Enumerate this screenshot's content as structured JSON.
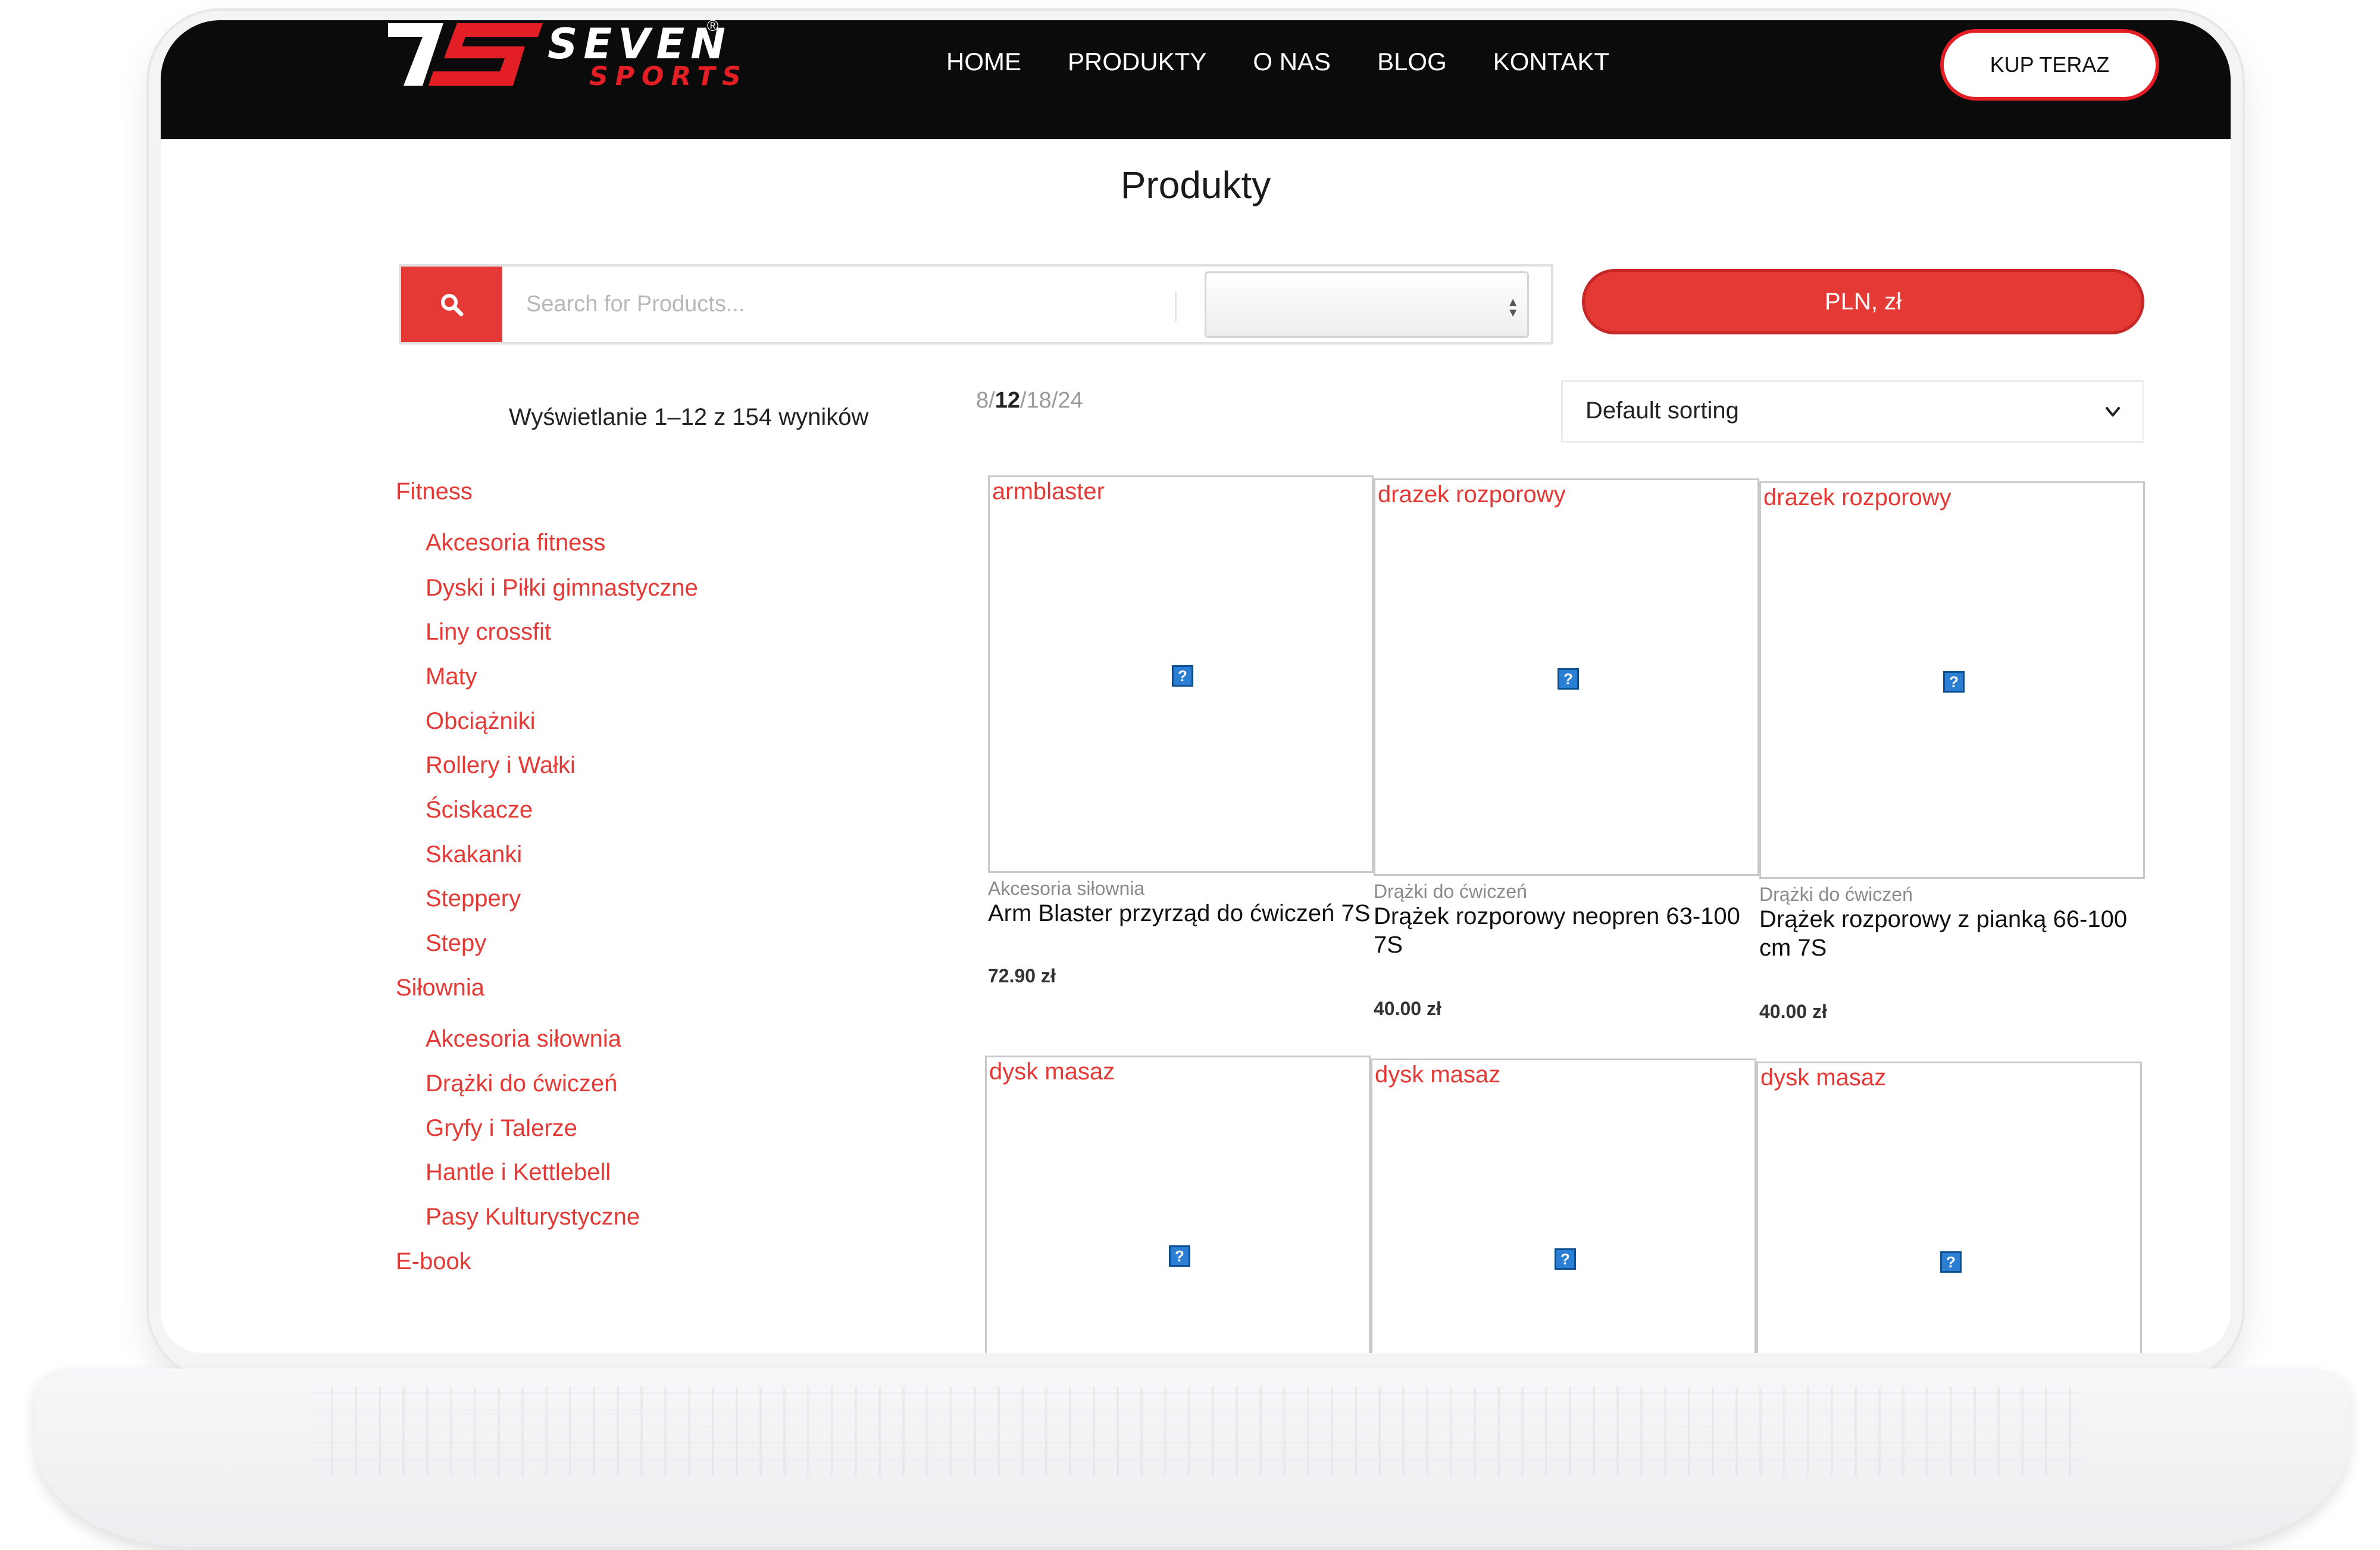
{
  "brand": {
    "name": "SEVEN",
    "sub": "SPORTS",
    "reg": "®",
    "primary_color": "#e31e24"
  },
  "nav": [
    "HOME",
    "PRODUKTY",
    "O NAS",
    "BLOG",
    "KONTAKT"
  ],
  "buy_button": "KUP TERAZ",
  "page_title": "Produkty",
  "search": {
    "placeholder": "Search for Products...",
    "category_value": ""
  },
  "currency_button": "PLN, zł",
  "results_count": "Wyświetlanie 1–12 z 154 wyników",
  "per_page": {
    "options": [
      "8",
      "12",
      "18",
      "24"
    ],
    "selected": "12"
  },
  "sort": {
    "selected": "Default sorting"
  },
  "sidebar": [
    {
      "label": "Fitness",
      "level": 0
    },
    {
      "label": "Akcesoria fitness",
      "level": 1
    },
    {
      "label": "Dyski i Piłki gimnastyczne",
      "level": 1
    },
    {
      "label": "Liny crossfit",
      "level": 1
    },
    {
      "label": "Maty",
      "level": 1
    },
    {
      "label": "Obciążniki",
      "level": 1
    },
    {
      "label": "Rollery i Wałki",
      "level": 1
    },
    {
      "label": "Ściskacze",
      "level": 1
    },
    {
      "label": "Skakanki",
      "level": 1
    },
    {
      "label": "Steppery",
      "level": 1
    },
    {
      "label": "Stepy",
      "level": 1
    },
    {
      "label": "Siłownia",
      "level": 0
    },
    {
      "label": "Akcesoria siłownia",
      "level": 1
    },
    {
      "label": "Drążki do ćwiczeń",
      "level": 1
    },
    {
      "label": "Gryfy i Talerze",
      "level": 1
    },
    {
      "label": "Hantle i Kettlebell",
      "level": 1
    },
    {
      "label": "Pasy Kulturystyczne",
      "level": 1
    },
    {
      "label": "E-book",
      "level": 0
    }
  ],
  "products": [
    {
      "alt": "armblaster",
      "category": "Akcesoria siłownia",
      "name": "Arm Blaster przyrząd do ćwiczeń 7S",
      "price": "72.90 zł"
    },
    {
      "alt": "drazek rozporowy",
      "category": "Drążki do ćwiczeń",
      "name": "Drążek rozporowy neopren 63-100 7S",
      "price": "40.00 zł"
    },
    {
      "alt": "drazek rozporowy",
      "category": "Drążki do ćwiczeń",
      "name": "Drążek rozporowy z pianką 66-100 cm 7S",
      "price": "40.00 zł"
    },
    {
      "alt": "dysk masaz"
    },
    {
      "alt": "dysk masaz"
    },
    {
      "alt": "dysk masaz"
    }
  ]
}
